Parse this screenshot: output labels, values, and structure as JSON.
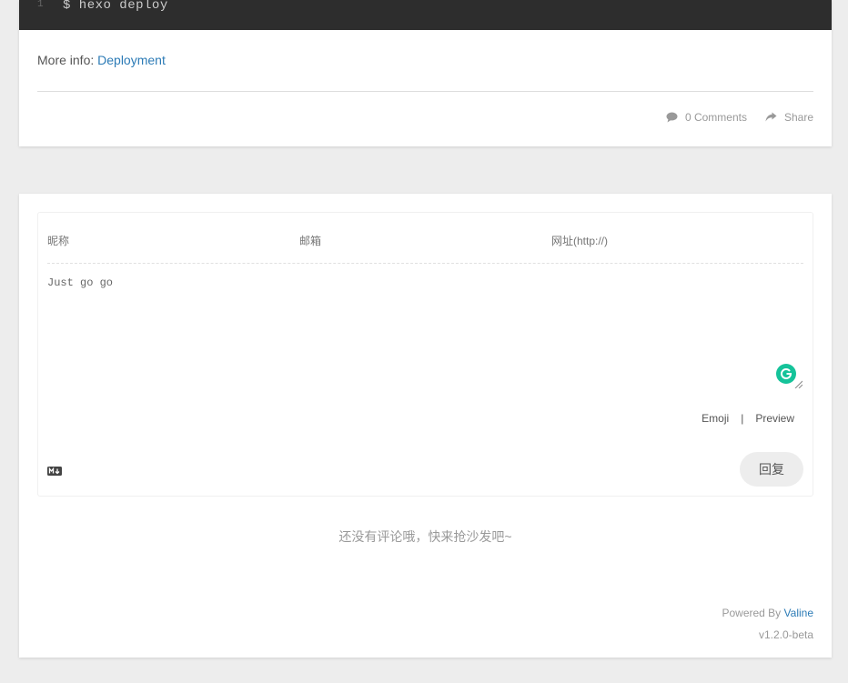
{
  "post": {
    "code": {
      "line_number": "1",
      "text": "$ hexo deploy"
    },
    "more_info_label": "More info:",
    "more_info_link": "Deployment",
    "comments_link": "0 Comments",
    "share_link": "Share"
  },
  "comment_form": {
    "nick_placeholder": "昵称",
    "mail_placeholder": "邮箱",
    "link_placeholder": "网址(http://)",
    "textarea_value": "Just go go",
    "emoji_label": "Emoji",
    "separator": "|",
    "preview_label": "Preview",
    "submit_label": "回复",
    "markdown_icon": "markdown-icon"
  },
  "empty_text": "还没有评论哦，快来抢沙发吧~",
  "footer": {
    "powered_by": "Powered By",
    "powered_link": "Valine",
    "version": "v1.2.0-beta"
  },
  "colors": {
    "link": "#2c7bb6",
    "code_bg": "#2d2d2d",
    "grammarly": "#15c39a"
  }
}
